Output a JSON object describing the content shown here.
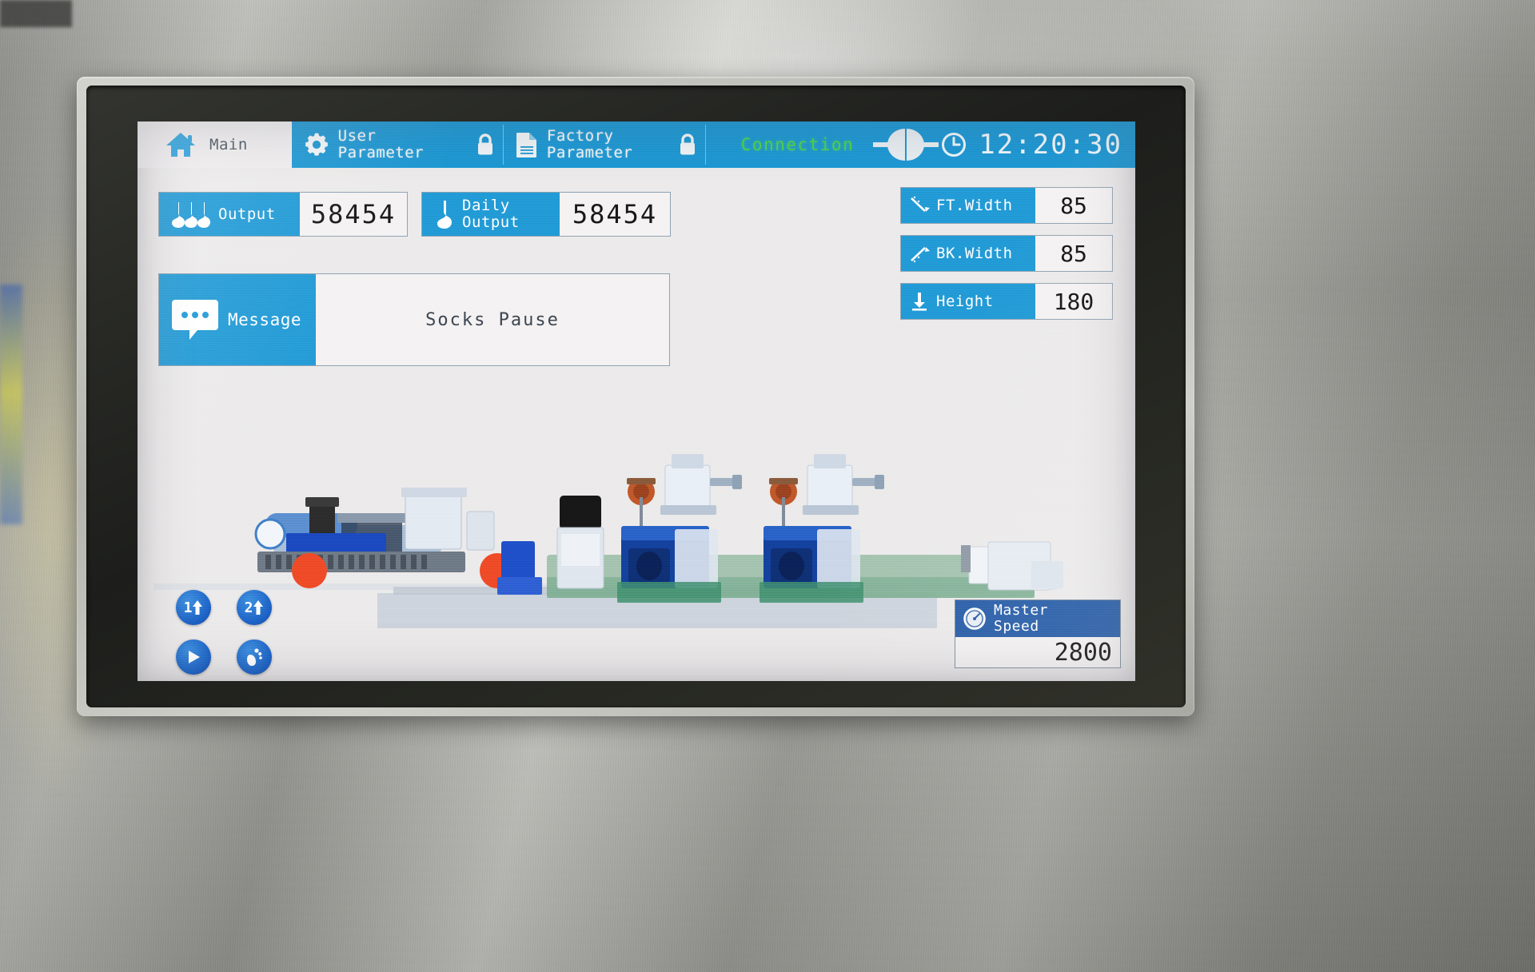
{
  "toolbar": {
    "tabs": [
      {
        "id": "main",
        "label": "Main",
        "icon": "home-icon",
        "active": true
      },
      {
        "id": "user",
        "label": "User\nParameter",
        "icon": "gear-icon",
        "active": false
      },
      {
        "id": "lock1",
        "label": "",
        "icon": "lock-icon",
        "active": false
      },
      {
        "id": "factory",
        "label": "Factory\nParameter",
        "icon": "document-icon",
        "active": false
      },
      {
        "id": "lock2",
        "label": "",
        "icon": "lock-icon",
        "active": false
      }
    ],
    "connection": {
      "label": "Connection",
      "icon": "plug-connected-icon",
      "color": "#4fd24a"
    },
    "clock": {
      "icon": "clock-icon",
      "time": "12:20:30"
    },
    "accent": "#1e97d3"
  },
  "counters": [
    {
      "id": "output",
      "label": "Output",
      "value": "58454",
      "icon": "three-socks-icon"
    },
    {
      "id": "daily_output",
      "label": "Daily\nOutput",
      "value": "58454",
      "icon": "sock-icon"
    }
  ],
  "message": {
    "label": "Message",
    "icon": "speech-bubble-icon",
    "text": "Socks Pause"
  },
  "measurements": [
    {
      "id": "ft_width",
      "label": "FT.Width",
      "value": "85",
      "icon": "slope-down-icon"
    },
    {
      "id": "bk_width",
      "label": "BK.Width",
      "value": "85",
      "icon": "slope-up-icon"
    },
    {
      "id": "height",
      "label": "Height",
      "value": "180",
      "icon": "down-arrow-baseline-icon"
    }
  ],
  "controls": [
    {
      "id": "cylinder1",
      "label": "1",
      "icon": "up-arrow-icon"
    },
    {
      "id": "cylinder2",
      "label": "2",
      "icon": "up-arrow-icon"
    },
    {
      "id": "run",
      "label": "",
      "icon": "play-icon"
    },
    {
      "id": "foot",
      "label": "",
      "icon": "footprint-icon"
    }
  ],
  "master_speed": {
    "label": "Master\nSpeed",
    "icon": "speedometer-icon",
    "value": "2800",
    "header_color": "#2a5ea8"
  }
}
